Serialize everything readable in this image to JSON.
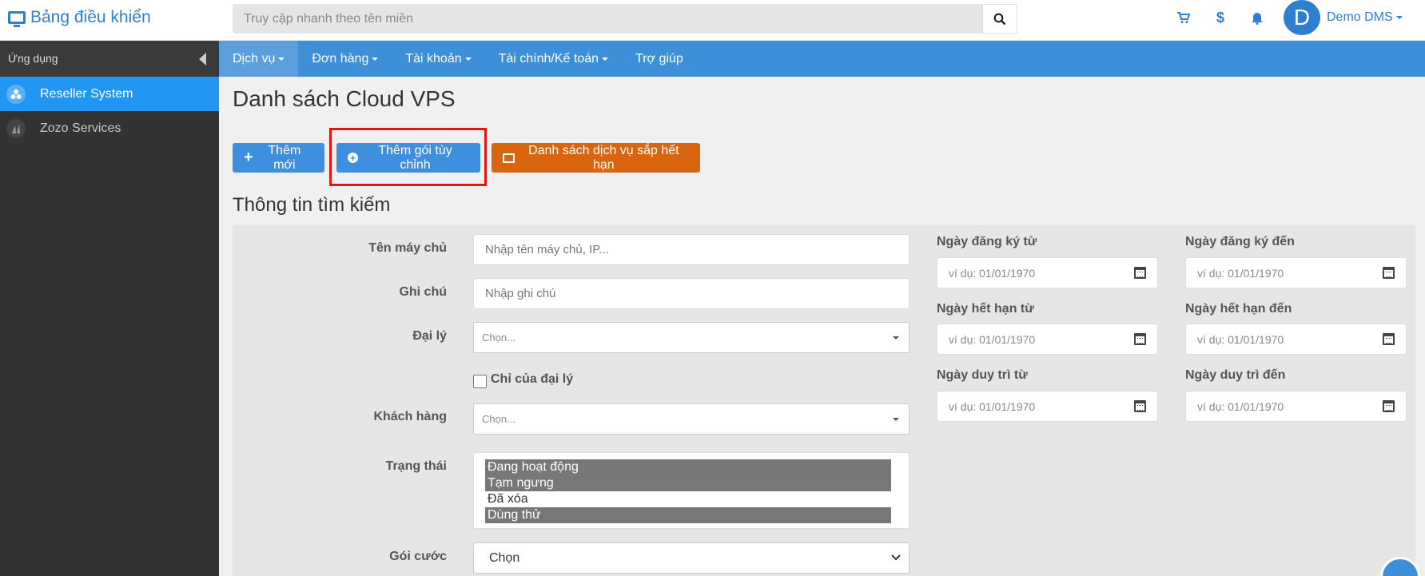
{
  "header": {
    "brand": "Bảng điều khiển",
    "search_placeholder": "Truy cập nhanh theo tên miền",
    "user_initial": "D",
    "user_name": "Demo DMS",
    "cart_icon": "cart-icon",
    "dollar_icon": "dollar-icon",
    "bell_icon": "bell-icon"
  },
  "sidebar": {
    "heading": "Ứng dụng",
    "items": [
      {
        "label": "Reseller System",
        "icon": "reseller-icon",
        "active": true
      },
      {
        "label": "Zozo Services",
        "icon": "zozo-icon",
        "active": false
      }
    ]
  },
  "nav": {
    "items": [
      {
        "label": "Dịch vụ",
        "has_caret": true,
        "active": true
      },
      {
        "label": "Đơn hàng",
        "has_caret": true
      },
      {
        "label": "Tài khoản",
        "has_caret": true
      },
      {
        "label": "Tài chính/Kế toán",
        "has_caret": true
      },
      {
        "label": "Trợ giúp",
        "has_caret": false
      }
    ]
  },
  "main": {
    "title": "Danh sách Cloud VPS",
    "buttons": {
      "add_new": "Thêm mới",
      "add_custom": "Thêm gói tùy chỉnh",
      "expiring_list": "Danh sách dịch vụ sắp hết hạn"
    },
    "search_section_title": "Thông tin tìm kiếm"
  },
  "form": {
    "server_name": {
      "label": "Tên máy chủ",
      "placeholder": "Nhập tên máy chủ, IP..."
    },
    "note": {
      "label": "Ghi chú",
      "placeholder": "Nhập ghi chú"
    },
    "agent": {
      "label": "Đại lý",
      "value": "Chọn..."
    },
    "agent_only": {
      "label": "Chỉ của đại lý"
    },
    "customer": {
      "label": "Khách hàng",
      "value": "Chọn..."
    },
    "status": {
      "label": "Trạng thái",
      "options": [
        {
          "label": "Đang hoạt động",
          "selected": true
        },
        {
          "label": "Tạm ngưng",
          "selected": true
        },
        {
          "label": "Đã xóa",
          "selected": false
        },
        {
          "label": "Dùng thử",
          "selected": true
        }
      ]
    },
    "plan": {
      "label": "Gói cước",
      "value": "Chọn"
    },
    "dates": {
      "reg_from": {
        "label": "Ngày đăng ký từ",
        "placeholder": "ví dụ: 01/01/1970"
      },
      "reg_to": {
        "label": "Ngày đăng ký đến",
        "placeholder": "ví dụ: 01/01/1970"
      },
      "exp_from": {
        "label": "Ngày hết hạn từ",
        "placeholder": "ví dụ: 01/01/1970"
      },
      "exp_to": {
        "label": "Ngày hết hạn đến",
        "placeholder": "ví dụ: 01/01/1970"
      },
      "maint_from": {
        "label": "Ngày duy trì từ",
        "placeholder": "ví dụ: 01/01/1970"
      },
      "maint_to": {
        "label": "Ngày duy trì đến",
        "placeholder": "ví dụ: 01/01/1970"
      }
    }
  },
  "colors": {
    "accent": "#3d8fd8",
    "sidebar": "#333333",
    "active_item": "#2196f3",
    "orange": "#d9650f",
    "highlight": "#e01515"
  }
}
